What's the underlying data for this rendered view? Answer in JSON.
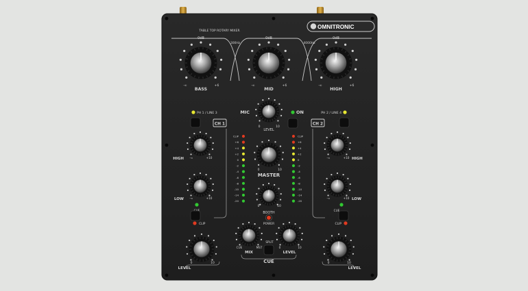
{
  "brand": "OMNITRONIC",
  "subtitle": "TABLE TOP ROTARY MIXER",
  "colors": {
    "background": "#e3e4e2",
    "panel": "#232323",
    "text": "#d6d6d6",
    "led_green": "#32c832",
    "led_yellow": "#e6e632",
    "led_red": "#e03a20",
    "connector": "#c8962c"
  },
  "eq": {
    "bass": {
      "label": "BASS",
      "top": "0dB",
      "left": "-∞",
      "right": "+6"
    },
    "mid": {
      "label": "MID",
      "top": "0dB",
      "left": "-∞",
      "right": "+6"
    },
    "high": {
      "label": "HIGH",
      "top": "0dB",
      "left": "-∞",
      "right": "+6"
    },
    "freq_low": "300Hz",
    "freq_high": "4000Hz"
  },
  "mic": {
    "label": "MIC",
    "on_label": "ON",
    "level_label": "LEVEL",
    "min": "0",
    "max": "10"
  },
  "ch1": {
    "name": "CH 1",
    "input_label": "PH 1 / LINE 3",
    "high_label": "HIGH",
    "low_label": "LOW",
    "cue_label": "CUE",
    "clip_label": "CLIP",
    "level_label": "LEVEL",
    "eq_min": "-∞",
    "eq_max": "+10",
    "level_min": "0",
    "level_max": "10"
  },
  "ch2": {
    "name": "CH 2",
    "input_label": "PH 2 / LINE 4",
    "high_label": "HIGH",
    "low_label": "LOW",
    "cue_label": "CUE",
    "clip_label": "CLIP",
    "level_label": "LEVEL",
    "eq_min": "-∞",
    "eq_max": "+10",
    "level_min": "0",
    "level_max": "10"
  },
  "meter_scale": [
    "CLIP",
    "+6",
    "+4",
    "+2",
    "0",
    "-2",
    "-4",
    "-6",
    "-8",
    "-10",
    "-14",
    "-20"
  ],
  "meter_colors": [
    "red",
    "red",
    "yellow",
    "yellow",
    "yellow",
    "green",
    "green",
    "green",
    "green",
    "green",
    "green",
    "green"
  ],
  "master": {
    "label": "MASTER",
    "min": "0",
    "max": "10"
  },
  "booth": {
    "label": "BOOTH",
    "min": "0",
    "max": "10"
  },
  "power": {
    "label": "POWER"
  },
  "cue": {
    "title": "CUE",
    "mix_label": "MIX",
    "level_label": "LEVEL",
    "split_label": "SPLIT",
    "cue_side": "CUE",
    "mst_side": "MST",
    "min": "0",
    "max": "10"
  }
}
